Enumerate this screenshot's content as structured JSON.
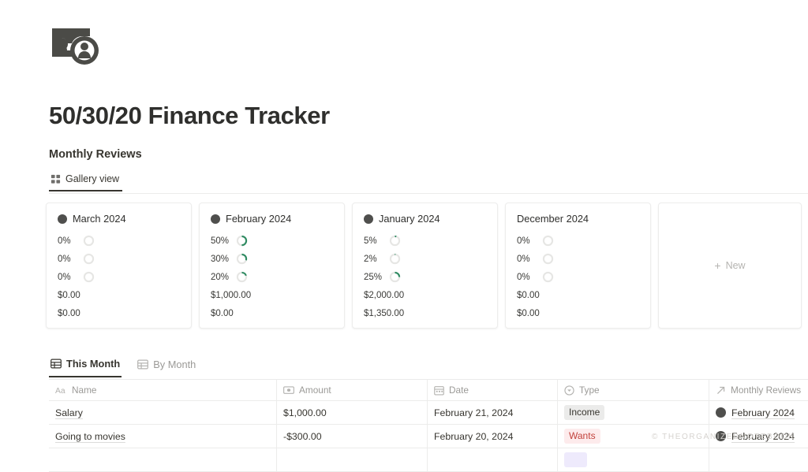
{
  "page": {
    "icon_name": "money-person-icon",
    "title": "50/30/20 Finance Tracker"
  },
  "gallery_section": {
    "database_title": "Monthly Reviews",
    "view_tab": {
      "label": "Gallery view",
      "icon": "gallery-grid-icon"
    },
    "new_card": {
      "label": "New",
      "icon": "plus-icon"
    },
    "cards": [
      {
        "title": "March 2024",
        "has_dot": true,
        "percents": [
          "0%",
          "0%",
          "0%"
        ],
        "ring_values": [
          0,
          0,
          0
        ],
        "amounts": [
          "$0.00",
          "$0.00"
        ]
      },
      {
        "title": "February 2024",
        "has_dot": true,
        "percents": [
          "50%",
          "30%",
          "20%"
        ],
        "ring_values": [
          50,
          30,
          20
        ],
        "amounts": [
          "$1,000.00",
          "$0.00"
        ]
      },
      {
        "title": "January 2024",
        "has_dot": true,
        "percents": [
          "5%",
          "2%",
          "25%"
        ],
        "ring_values": [
          5,
          2,
          25
        ],
        "amounts": [
          "$2,000.00",
          "$1,350.00"
        ]
      },
      {
        "title": "December 2024",
        "has_dot": false,
        "percents": [
          "0%",
          "0%",
          "0%"
        ],
        "ring_values": [
          0,
          0,
          0
        ],
        "amounts": [
          "$0.00",
          "$0.00"
        ]
      }
    ]
  },
  "table_section": {
    "tabs": [
      {
        "label": "This Month",
        "icon": "table-icon",
        "active": true
      },
      {
        "label": "By Month",
        "icon": "table-icon",
        "active": false
      }
    ],
    "columns": [
      {
        "label": "Name",
        "icon": "text-aa-icon"
      },
      {
        "label": "Amount",
        "icon": "money-icon"
      },
      {
        "label": "Date",
        "icon": "calendar-icon"
      },
      {
        "label": "Type",
        "icon": "select-circle-icon"
      },
      {
        "label": "Monthly Reviews",
        "icon": "relation-arrow-icon"
      }
    ],
    "add_column_label": "+",
    "rows": [
      {
        "name": "Salary",
        "amount": "$1,000.00",
        "date": "February 21, 2024",
        "type": "Income",
        "type_style": "income",
        "relation": "February 2024"
      },
      {
        "name": "Going to movies",
        "amount": "-$300.00",
        "date": "February 20, 2024",
        "type": "Wants",
        "type_style": "wants",
        "relation": "February 2024"
      },
      {
        "name": "",
        "amount": "",
        "date": "",
        "type": "",
        "type_style": "needs",
        "relation": ""
      }
    ]
  },
  "watermark": {
    "text": "© THEORGANIZEDNOTEBOOK"
  },
  "colors": {
    "accent_green": "#2f8b62",
    "ring_track": "#e6e6e4",
    "dot_dark": "#4f4f4d",
    "badge_income_bg": "#ebebea",
    "badge_wants_bg": "#fdebec",
    "badge_wants_fg": "#c2423c",
    "badge_needs_bg": "#eeeafc",
    "text_primary": "#37352f",
    "text_muted": "#9b9a97",
    "border": "#ececeb"
  }
}
